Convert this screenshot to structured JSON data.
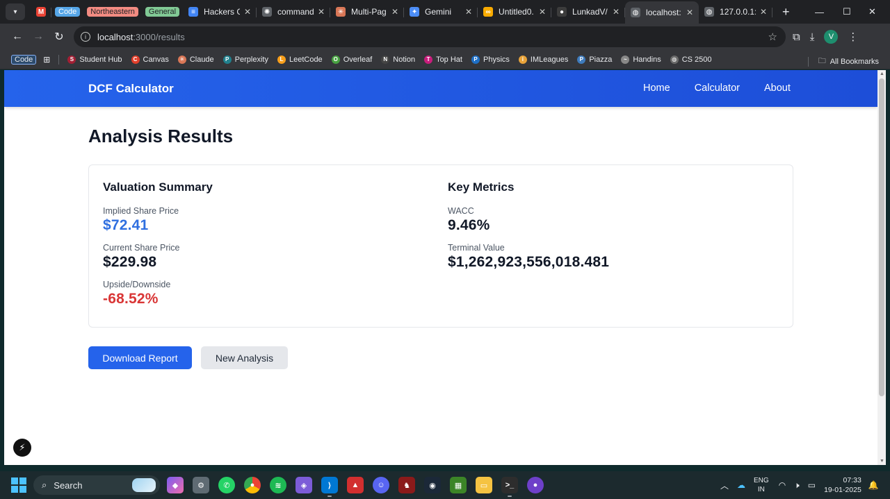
{
  "browser": {
    "tabs": [
      {
        "label": "",
        "icon": "gmail-icon",
        "color": "#ea4335",
        "glyph": "M"
      },
      {
        "label": "Code",
        "pill": "code"
      },
      {
        "label": "Northeastern",
        "pill": "ne"
      },
      {
        "label": "General",
        "pill": "gen"
      },
      {
        "label": "Hackers G",
        "icon": "docs-icon",
        "color": "#4285f4",
        "glyph": "≡"
      },
      {
        "label": "command",
        "icon": "chatgpt-icon",
        "color": "#5f6368",
        "glyph": "✺"
      },
      {
        "label": "Multi-Pag",
        "icon": "claude-icon",
        "color": "#d97757",
        "glyph": "✳"
      },
      {
        "label": "Gemini",
        "icon": "gemini-icon",
        "color": "#4c8df6",
        "glyph": "✦"
      },
      {
        "label": "Untitled0.",
        "icon": "colab-icon",
        "color": "#f9ab00",
        "glyph": "∞"
      },
      {
        "label": "LunkadV/",
        "icon": "github-icon",
        "color": "#3c3c3c",
        "glyph": "●"
      },
      {
        "label": "localhost:",
        "icon": "globe-icon",
        "color": "#5f6368",
        "glyph": "◍",
        "active": true
      },
      {
        "label": "127.0.0.1:",
        "icon": "globe-icon",
        "color": "#5f6368",
        "glyph": "◍"
      }
    ],
    "url_host": "localhost",
    "url_path": ":3000/results",
    "avatar_letter": "V",
    "bookmarks_code": "Code",
    "bookmarks": [
      {
        "label": "Student Hub",
        "color": "#a31f34",
        "glyph": "S"
      },
      {
        "label": "Canvas",
        "color": "#e13f2b",
        "glyph": "C"
      },
      {
        "label": "Claude",
        "color": "#d97757",
        "glyph": "✳"
      },
      {
        "label": "Perplexity",
        "color": "#20808d",
        "glyph": "P"
      },
      {
        "label": "LeetCode",
        "color": "#f89f1b",
        "glyph": "L"
      },
      {
        "label": "Overleaf",
        "color": "#47a141",
        "glyph": "O"
      },
      {
        "label": "Notion",
        "color": "#444444",
        "glyph": "N"
      },
      {
        "label": "Top Hat",
        "color": "#c81d7c",
        "glyph": "T"
      },
      {
        "label": "Physics",
        "color": "#1e6fc6",
        "glyph": "P"
      },
      {
        "label": "IMLeagues",
        "color": "#e8a33a",
        "glyph": "i"
      },
      {
        "label": "Piazza",
        "color": "#3e7bbd",
        "glyph": "P"
      },
      {
        "label": "Handins",
        "color": "#888888",
        "glyph": "~"
      },
      {
        "label": "CS 2500",
        "color": "#6b6b6b",
        "glyph": "◍"
      }
    ],
    "all_bookmarks": "All Bookmarks"
  },
  "site": {
    "brand": "DCF Calculator",
    "nav": [
      "Home",
      "Calculator",
      "About"
    ]
  },
  "results": {
    "title": "Analysis Results",
    "summary": {
      "heading": "Valuation Summary",
      "implied_label": "Implied Share Price",
      "implied_value": "$72.41",
      "current_label": "Current Share Price",
      "current_value": "$229.98",
      "upside_label": "Upside/Downside",
      "upside_value": "-68.52%",
      "colors": {
        "implied": "#2f6fe0",
        "upside": "#d93636"
      }
    },
    "metrics": {
      "heading": "Key Metrics",
      "wacc_label": "WACC",
      "wacc_value": "9.46%",
      "tv_label": "Terminal Value",
      "tv_value": "$1,262,923,556,018.481"
    },
    "buttons": {
      "download": "Download Report",
      "new": "New Analysis"
    }
  },
  "taskbar": {
    "search": "Search",
    "lang_top": "ENG",
    "lang_bottom": "IN",
    "time": "07:33",
    "date": "19-01-2025"
  }
}
